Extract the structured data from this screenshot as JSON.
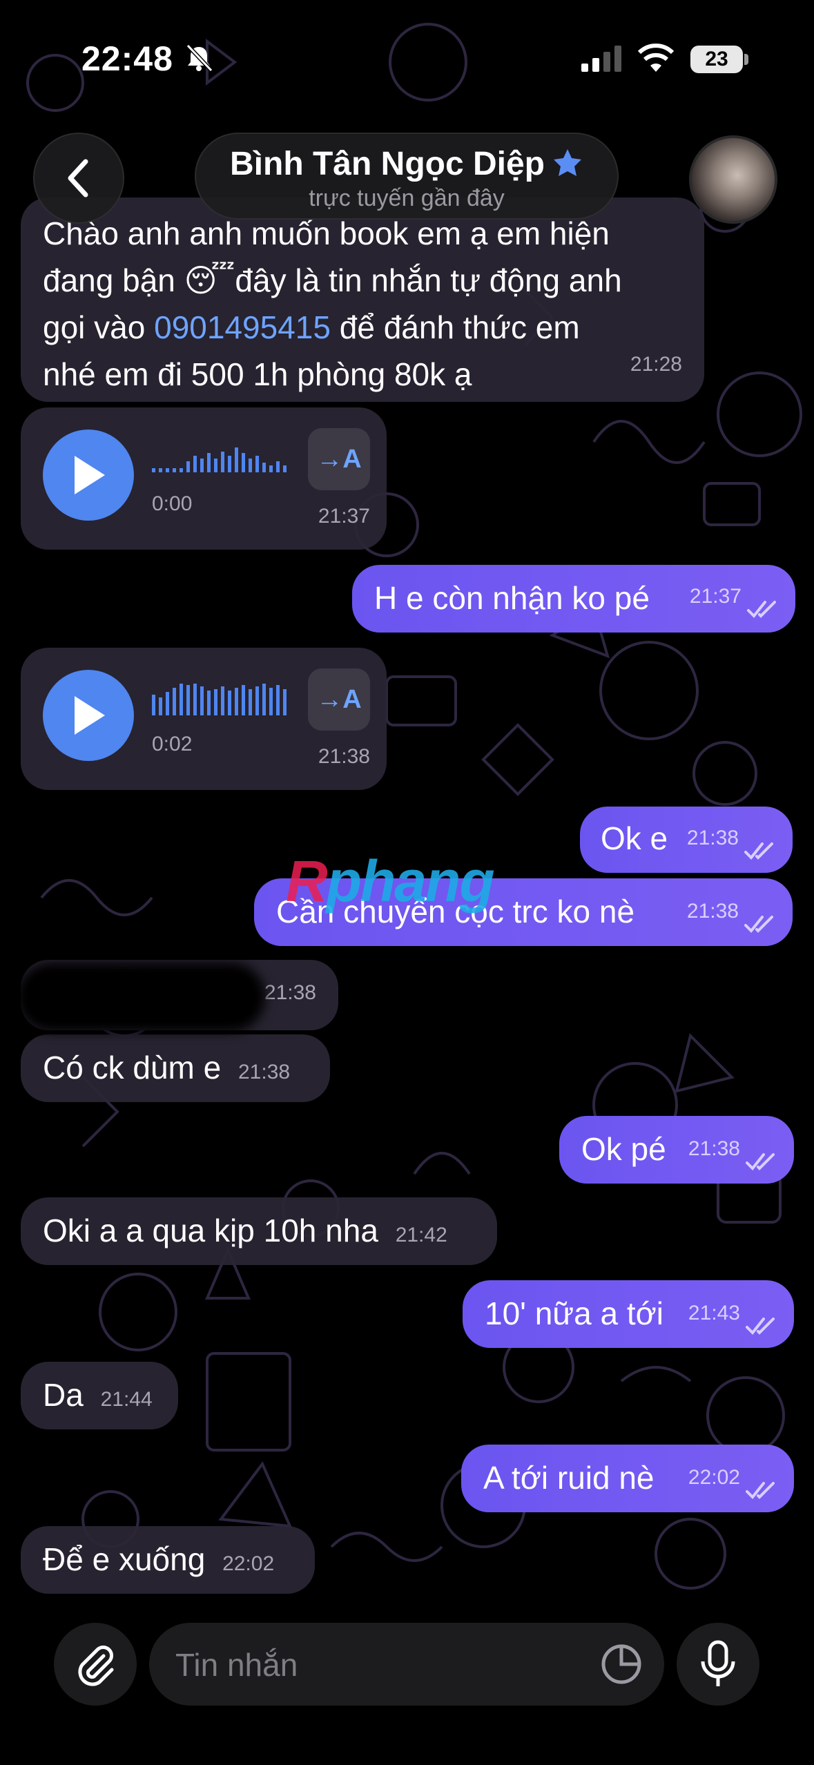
{
  "status_bar": {
    "time": "22:48",
    "battery": "23"
  },
  "header": {
    "contact_name": "Bình Tân Ngọc Diệp",
    "contact_status": "trực tuyến gần đây"
  },
  "watermark": {
    "part1": "R",
    "part2": "phang"
  },
  "messages": [
    {
      "dir": "in",
      "line1": "Chào anh anh muốn book em ạ em hiện",
      "line2": "đang bận 😴đây là tin nhắn tự động anh",
      "line3_pre": "gọi vào ",
      "phone": "0901495415",
      "line3_post": " để đánh thức em",
      "line4": "nhé em đi 500 1h phòng 80k ạ",
      "time": "21:28"
    },
    {
      "dir": "in",
      "type": "voice",
      "duration": "0:00",
      "transcribe": "→A",
      "time": "21:37"
    },
    {
      "dir": "out",
      "text": "H e còn nhận ko pé",
      "time": "21:37"
    },
    {
      "dir": "in",
      "type": "voice",
      "duration": "0:02",
      "transcribe": "→A",
      "time": "21:38"
    },
    {
      "dir": "out",
      "text": "Ok e",
      "time": "21:38"
    },
    {
      "dir": "out",
      "text": "Cần chuyển cọc trc ko nè",
      "time": "21:38"
    },
    {
      "dir": "in",
      "text": "",
      "time": "21:38"
    },
    {
      "dir": "in",
      "text": "Có ck dùm e",
      "time": "21:38"
    },
    {
      "dir": "out",
      "text": "Ok pé",
      "time": "21:38"
    },
    {
      "dir": "in",
      "text": "Oki a a qua kịp 10h nha",
      "time": "21:42"
    },
    {
      "dir": "out",
      "text": "10' nữa a tới",
      "time": "21:43"
    },
    {
      "dir": "in",
      "text": "Da",
      "time": "21:44"
    },
    {
      "dir": "out",
      "text": "A tới ruid nè",
      "time": "22:02"
    },
    {
      "dir": "in",
      "text": "Để e xuống",
      "time": "22:02"
    }
  ],
  "input": {
    "placeholder": "Tin nhắn"
  },
  "colors": {
    "accent": "#6b55f0",
    "link": "#6ea4ff",
    "voice": "#4f86f0"
  }
}
